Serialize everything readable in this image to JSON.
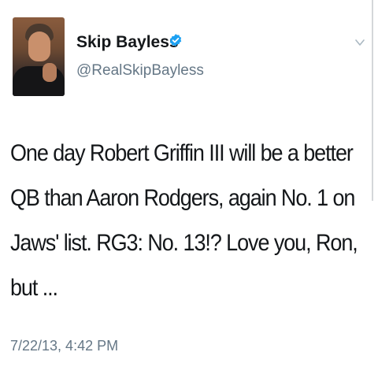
{
  "profile": {
    "display_name": "Skip Bayless",
    "handle": "@RealSkipBayless",
    "verified": true,
    "verified_icon": "verified-badge-icon",
    "verified_color": "#1da1f2"
  },
  "menu": {
    "icon": "chevron-down-icon"
  },
  "tweet": {
    "text": "One day Robert Griffin III will be a better QB than Aaron Rodgers, again No. 1 on Jaws' list. RG3: No. 13!? Love you, Ron, but ...",
    "timestamp": "7/22/13, 4:42 PM"
  },
  "colors": {
    "text": "#14171a",
    "secondary": "#657786",
    "background": "#ffffff"
  }
}
